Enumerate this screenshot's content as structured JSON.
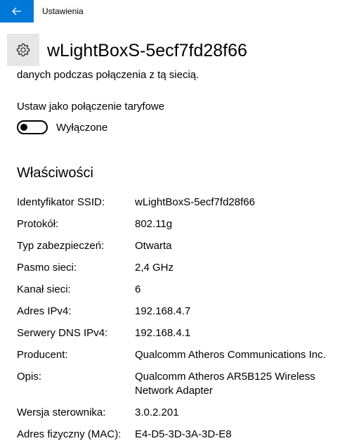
{
  "window": {
    "title": "Ustawienia",
    "back_icon": "arrow-left-icon",
    "accent_color": "#0078d7"
  },
  "header": {
    "icon": "gear-icon",
    "title": "wLightBoxS-5ecf7fd28f66"
  },
  "partial_text": "danych podczas połączenia z tą siecią.",
  "metered": {
    "label": "Ustaw jako połączenie taryfowe",
    "state": "Wyłączone",
    "on": false
  },
  "properties": {
    "title": "Właściwości",
    "rows": [
      {
        "key": "Identyfikator SSID:",
        "value": "wLightBoxS-5ecf7fd28f66"
      },
      {
        "key": "Protokół:",
        "value": "802.11g"
      },
      {
        "key": "Typ zabezpieczeń:",
        "value": "Otwarta"
      },
      {
        "key": "Pasmo sieci:",
        "value": "2,4 GHz"
      },
      {
        "key": "Kanał sieci:",
        "value": "6"
      },
      {
        "key": "Adres IPv4:",
        "value": "192.168.4.7"
      },
      {
        "key": "Serwery DNS IPv4:",
        "value": "192.168.4.1"
      },
      {
        "key": "Producent:",
        "value": "Qualcomm Atheros Communications Inc."
      },
      {
        "key": "Opis:",
        "value": "Qualcomm Atheros AR5B125 Wireless Network Adapter"
      },
      {
        "key": "Wersja sterownika:",
        "value": "3.0.2.201"
      },
      {
        "key": "Adres fizyczny (MAC):",
        "value": "E4-D5-3D-3A-3D-E8"
      }
    ]
  }
}
